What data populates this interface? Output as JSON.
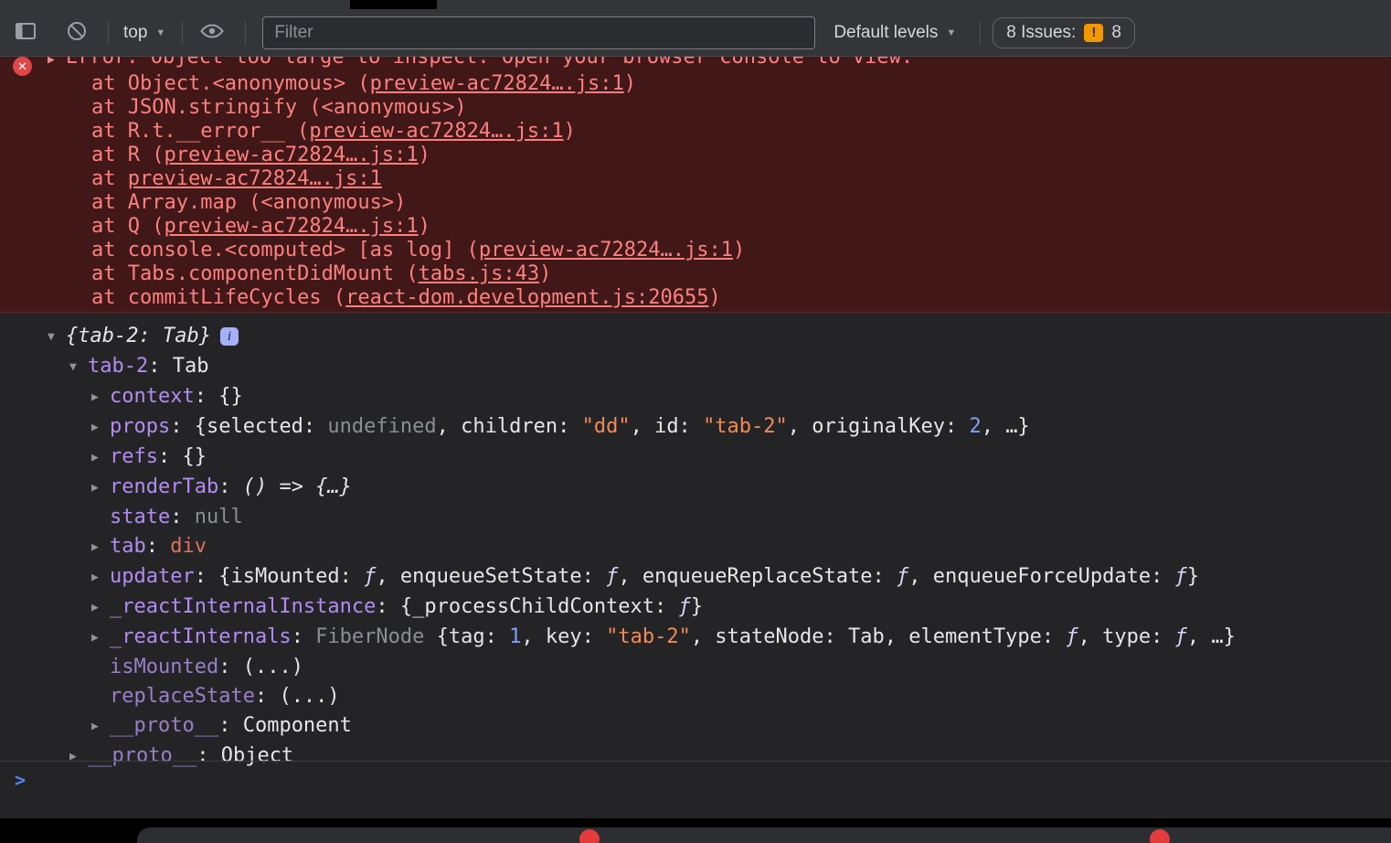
{
  "toolbar": {
    "frame_context": "top",
    "filter_placeholder": "Filter",
    "levels_label": "Default levels",
    "issues_label": "8 Issues:",
    "issues_count": "8"
  },
  "icons": {
    "caret_down": "▼",
    "expand_open": "▼",
    "expand_closed": "▶",
    "error_x": "✕",
    "issues_exclamation": "!",
    "info": "i",
    "prompt_chevron": ">"
  },
  "colors": {
    "error_text": "#ff8080",
    "error_bg": "#421718",
    "key_purple": "#b18cf0",
    "string_orange": "#f28b54",
    "number_blue": "#7da2f8",
    "tag_red": "#e0705c",
    "issues_orange": "#f29900",
    "prompt_blue": "#4e87f0"
  },
  "error": {
    "message": "Error: Object too large to inspect. Open your browser console to view.",
    "stack": [
      {
        "pre": "at Object.<anonymous> (",
        "link": "preview-ac72824….js:1",
        "post": ")"
      },
      {
        "pre": "at JSON.stringify (<anonymous>)",
        "link": "",
        "post": ""
      },
      {
        "pre": "at R.t.__error__ (",
        "link": "preview-ac72824….js:1",
        "post": ")"
      },
      {
        "pre": "at R (",
        "link": "preview-ac72824….js:1",
        "post": ")"
      },
      {
        "pre": "at ",
        "link": "preview-ac72824….js:1",
        "post": ""
      },
      {
        "pre": "at Array.map (<anonymous>)",
        "link": "",
        "post": ""
      },
      {
        "pre": "at Q (",
        "link": "preview-ac72824….js:1",
        "post": ")"
      },
      {
        "pre": "at console.<computed> [as log] (",
        "link": "preview-ac72824….js:1",
        "post": ")"
      },
      {
        "pre": "at Tabs.componentDidMount (",
        "link": "tabs.js:43",
        "post": ")"
      },
      {
        "pre": "at commitLifeCycles (",
        "link": "react-dom.development.js:20655",
        "post": ")"
      }
    ]
  },
  "tree": {
    "rows": [
      {
        "indent": 0,
        "exp": "open",
        "badge": true,
        "seg": [
          [
            "i",
            "{tab-2: Tab}"
          ]
        ]
      },
      {
        "indent": 1,
        "exp": "open",
        "seg": [
          [
            "k",
            "tab-2"
          ],
          [
            "w",
            ": Tab"
          ]
        ]
      },
      {
        "indent": 2,
        "exp": "closed",
        "seg": [
          [
            "k",
            "context"
          ],
          [
            "w",
            ": {}"
          ]
        ]
      },
      {
        "indent": 2,
        "exp": "closed",
        "seg": [
          [
            "k",
            "props"
          ],
          [
            "w",
            ": {selected: "
          ],
          [
            "g",
            "undefined"
          ],
          [
            "w",
            ", children: "
          ],
          [
            "s",
            "\"dd\""
          ],
          [
            "w",
            ", id: "
          ],
          [
            "s",
            "\"tab-2\""
          ],
          [
            "w",
            ", originalKey: "
          ],
          [
            "n",
            "2"
          ],
          [
            "w",
            ", …}"
          ]
        ]
      },
      {
        "indent": 2,
        "exp": "closed",
        "seg": [
          [
            "k",
            "refs"
          ],
          [
            "w",
            ": {}"
          ]
        ]
      },
      {
        "indent": 2,
        "exp": "closed",
        "seg": [
          [
            "k",
            "renderTab"
          ],
          [
            "w",
            ": "
          ],
          [
            "i",
            "() => {…}"
          ]
        ]
      },
      {
        "indent": 2,
        "exp": "none",
        "seg": [
          [
            "k",
            "state"
          ],
          [
            "w",
            ": "
          ],
          [
            "g",
            "null"
          ]
        ]
      },
      {
        "indent": 2,
        "exp": "closed",
        "seg": [
          [
            "k",
            "tab"
          ],
          [
            "w",
            ": "
          ],
          [
            "t",
            "div"
          ]
        ]
      },
      {
        "indent": 2,
        "exp": "closed",
        "seg": [
          [
            "k",
            "updater"
          ],
          [
            "w",
            ": {isMounted: "
          ],
          [
            "f",
            "ƒ"
          ],
          [
            "w",
            ", enqueueSetState: "
          ],
          [
            "f",
            "ƒ"
          ],
          [
            "w",
            ", enqueueReplaceState: "
          ],
          [
            "f",
            "ƒ"
          ],
          [
            "w",
            ", enqueueForceUpdate: "
          ],
          [
            "f",
            "ƒ"
          ],
          [
            "w",
            "}"
          ]
        ]
      },
      {
        "indent": 2,
        "exp": "closed",
        "seg": [
          [
            "k",
            "_reactInternalInstance"
          ],
          [
            "w",
            ": {_processChildContext: "
          ],
          [
            "f",
            "ƒ"
          ],
          [
            "w",
            "}"
          ]
        ]
      },
      {
        "indent": 2,
        "exp": "closed",
        "seg": [
          [
            "k",
            "_reactInternals"
          ],
          [
            "w",
            ": "
          ],
          [
            "g",
            "FiberNode "
          ],
          [
            "w",
            "{tag: "
          ],
          [
            "n",
            "1"
          ],
          [
            "w",
            ", key: "
          ],
          [
            "s",
            "\"tab-2\""
          ],
          [
            "w",
            ", stateNode: Tab, elementType: "
          ],
          [
            "f",
            "ƒ"
          ],
          [
            "w",
            ", type: "
          ],
          [
            "f",
            "ƒ"
          ],
          [
            "w",
            ", …}"
          ]
        ]
      },
      {
        "indent": 2,
        "exp": "none",
        "seg": [
          [
            "kd",
            "isMounted"
          ],
          [
            "w",
            ": (...)"
          ]
        ]
      },
      {
        "indent": 2,
        "exp": "none",
        "seg": [
          [
            "kd",
            "replaceState"
          ],
          [
            "w",
            ": (...)"
          ]
        ]
      },
      {
        "indent": 2,
        "exp": "closed",
        "seg": [
          [
            "kd",
            "__proto__"
          ],
          [
            "w",
            ": Component"
          ]
        ]
      },
      {
        "indent": 1,
        "exp": "closed",
        "seg": [
          [
            "kd",
            "__proto__"
          ],
          [
            "w",
            ": Object"
          ]
        ]
      }
    ]
  },
  "prompt": {}
}
